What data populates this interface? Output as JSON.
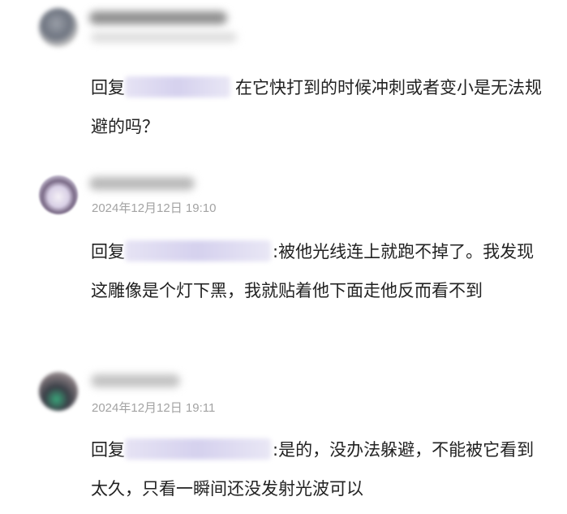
{
  "comments": [
    {
      "reply_prefix": "回复",
      "text": "在它快打到的时候冲刺或者变小是无法规避的吗？"
    },
    {
      "timestamp": "2024年12月12日 19:10",
      "reply_prefix": "回复",
      "text": ":被他光线连上就跑不掉了。我发现这雕像是个灯下黑，我就贴着他下面走他反而看不到"
    },
    {
      "timestamp": "2024年12月12日 19:11",
      "reply_prefix": "回复",
      "text": ":是的，没办法躲避，不能被它看到太久，只看一瞬间还没发射光波可以"
    }
  ]
}
